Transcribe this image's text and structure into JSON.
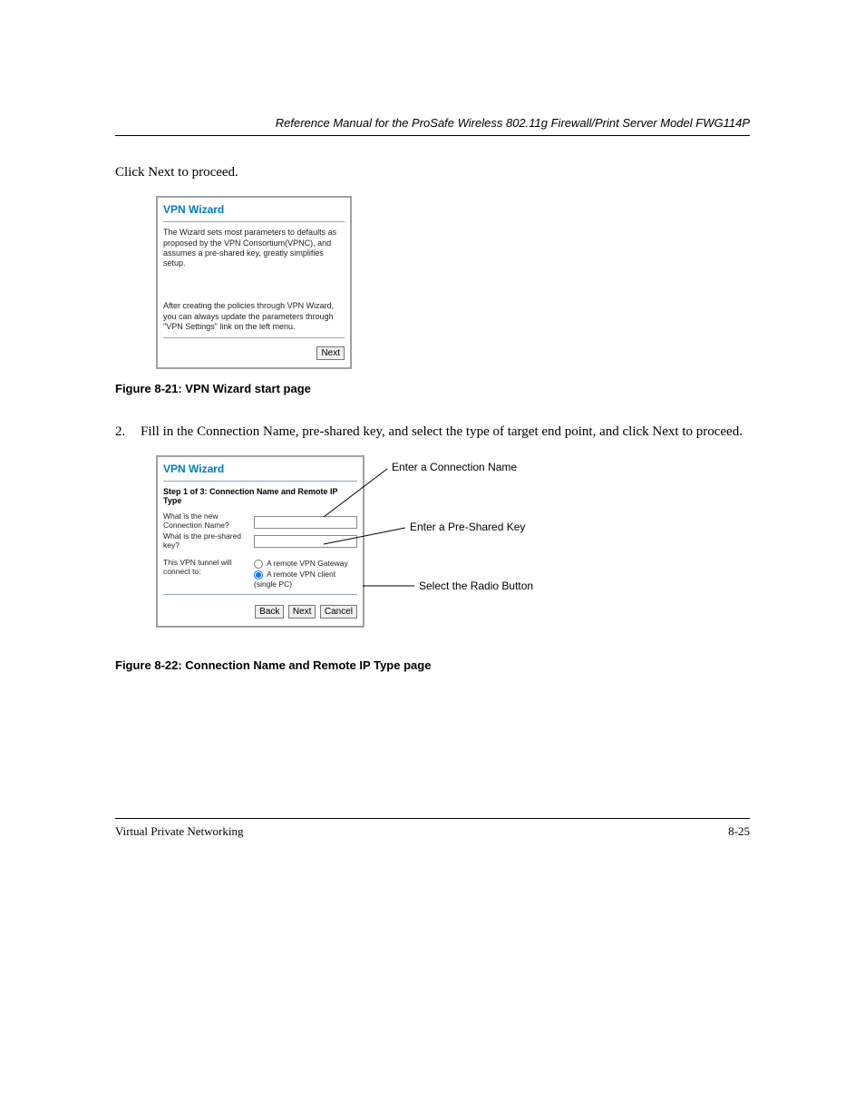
{
  "running_head": "Reference Manual for the ProSafe Wireless 802.11g  Firewall/Print Server Model FWG114P",
  "intro_text": "Click Next to proceed.",
  "wizard1": {
    "title": "VPN Wizard",
    "para1": "The Wizard sets most parameters to defaults as proposed by the VPN Consortium(VPNC), and assumes a pre-shared key, greatly simplifies setup.",
    "para2": "After creating the policies through VPN Wizard, you can always update the parameters through \"VPN Settings\" link on the left menu.",
    "next": "Next"
  },
  "fig1_caption": "Figure 8-21:  VPN Wizard start page",
  "step2_intro": {
    "num": "2.",
    "text": "Fill in the Connection Name, pre-shared key, and select the type of target end point, and click Next to proceed."
  },
  "wizard2": {
    "title": "VPN Wizard",
    "step_label": "Step 1 of 3: Connection Name and Remote IP Type",
    "q_name": "What is the new Connection Name?",
    "q_key": "What is the pre-shared key?",
    "q_conn": "This VPN tunnel will connect to:",
    "radio1": "A remote VPN Gateway",
    "radio2": "A remote VPN client (single PC)",
    "back": "Back",
    "next": "Next",
    "cancel": "Cancel",
    "value_name": "",
    "value_key": ""
  },
  "callouts": {
    "c1": "Enter a Connection Name",
    "c2": "Enter a Pre-Shared Key",
    "c3": "Select the Radio Button"
  },
  "fig2_caption": "Figure 8-22:  Connection Name and Remote IP Type page",
  "foot_left": "Virtual Private Networking",
  "foot_right": "8-25"
}
